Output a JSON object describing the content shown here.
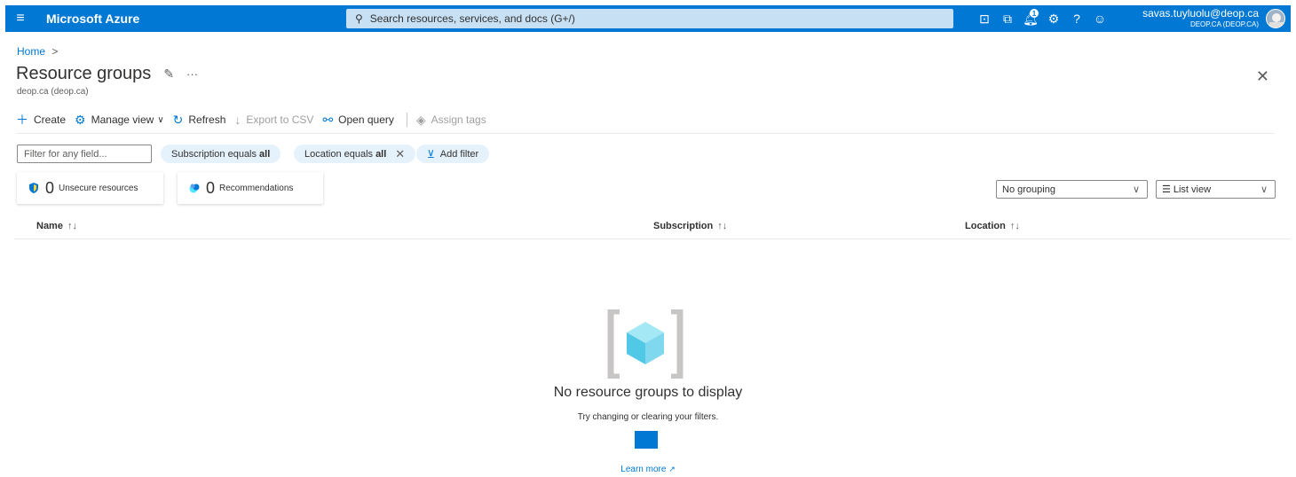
{
  "topbar": {
    "brand": "Microsoft Azure",
    "search_placeholder": "Search resources, services, and docs (G+/)",
    "notification_count": "1",
    "account_email": "savas.tuyluolu@deop.ca",
    "account_tenant": "DEOP.CA (DEOP.CA)"
  },
  "breadcrumb": {
    "home": "Home",
    "separator": ">"
  },
  "page": {
    "title": "Resource groups",
    "subtitle": "deop.ca (deop.ca)",
    "more": "···",
    "close": "✕"
  },
  "toolbar": {
    "create": "Create",
    "manage_view": "Manage view",
    "refresh": "Refresh",
    "export_csv": "Export to CSV",
    "open_query": "Open query",
    "assign_tags": "Assign tags"
  },
  "filters": {
    "placeholder": "Filter for any field...",
    "subscription_prefix": "Subscription equals",
    "subscription_value": "all",
    "location_prefix": "Location equals",
    "location_value": "all",
    "add_filter": "Add filter"
  },
  "summary": {
    "unsecure_count": "0",
    "unsecure_label": "Unsecure resources",
    "recommendations_count": "0",
    "recommendations_label": "Recommendations"
  },
  "view_controls": {
    "grouping": "No grouping",
    "view": "List view"
  },
  "table": {
    "columns": [
      {
        "label": "Name",
        "sort": "↑↓"
      },
      {
        "label": "Subscription",
        "sort": "↑↓"
      },
      {
        "label": "Location",
        "sort": "↑↓"
      }
    ]
  },
  "empty_state": {
    "title": "No resource groups to display",
    "subtitle": "Try changing or clearing your filters.",
    "learn_more": "Learn more"
  },
  "colors": {
    "accent": "#0078d4",
    "search_bg": "#c7e0f4",
    "pill_bg": "#e6f2fb"
  },
  "icons": [
    "hamburger-icon",
    "search-icon",
    "cloud-shell-icon",
    "directory-filter-icon",
    "notifications-icon",
    "settings-icon",
    "help-icon",
    "feedback-icon",
    "pin-icon",
    "plus-icon",
    "gear-icon",
    "refresh-icon",
    "download-icon",
    "query-icon",
    "tag-icon",
    "filter-icon",
    "shield-icon",
    "recommendation-icon",
    "chevron-down-icon",
    "list-icon",
    "close-icon",
    "external-link-icon"
  ]
}
